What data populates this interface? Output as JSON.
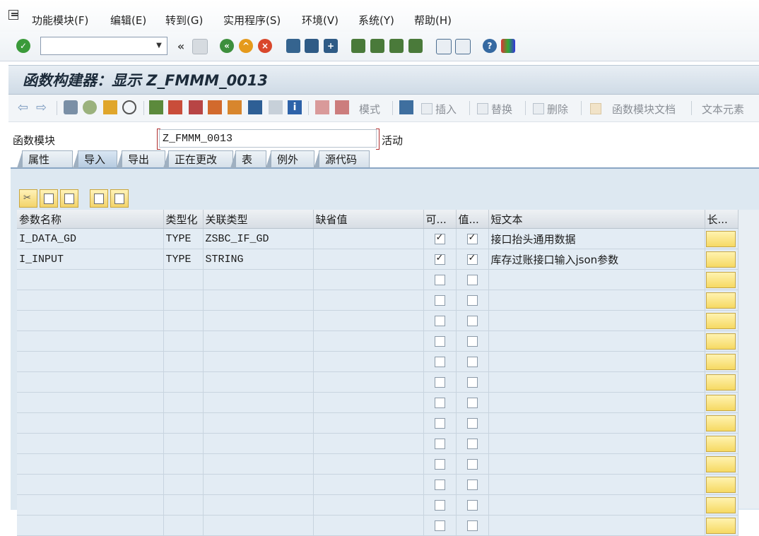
{
  "menu": {
    "items": [
      "功能模块(F)",
      "编辑(E)",
      "转到(G)",
      "实用程序(S)",
      "环境(V)",
      "系统(Y)",
      "帮助(H)"
    ]
  },
  "command_field": {
    "value": ""
  },
  "title": "函数构建器：显示 Z_FMMM_0013",
  "app_toolbar": {
    "mode_label": "模式",
    "insert_label": "插入",
    "replace_label": "替换",
    "delete_label": "删除",
    "fm_doc_label": "函数模块文档",
    "text_elements_label": "文本元素"
  },
  "function_module": {
    "label": "函数模块",
    "value": "Z_FMMM_0013",
    "status": "活动"
  },
  "tabs": [
    {
      "label": "属性"
    },
    {
      "label": "导入"
    },
    {
      "label": "导出"
    },
    {
      "label": "正在更改"
    },
    {
      "label": "表"
    },
    {
      "label": "例外"
    },
    {
      "label": "源代码"
    }
  ],
  "active_tab": "导入",
  "grid": {
    "columns": [
      "参数名称",
      "类型化",
      "关联类型",
      "缺省值",
      "可...",
      "值...",
      "短文本",
      "长..."
    ],
    "rows": [
      {
        "name": "I_DATA_GD",
        "typing": "TYPE",
        "assoc_type": "ZSBC_IF_GD",
        "default": "",
        "optional": true,
        "pass_value": true,
        "short_text": "接口抬头通用数据"
      },
      {
        "name": "I_INPUT",
        "typing": "TYPE",
        "assoc_type": "STRING",
        "default": "",
        "optional": true,
        "pass_value": true,
        "short_text": "库存过账接口输入json参数"
      }
    ],
    "empty_rows": 13
  },
  "colors": {
    "panel_bg": "#dde8f1",
    "long_button": "#f6d963",
    "green_check": "#3a9a3a"
  }
}
